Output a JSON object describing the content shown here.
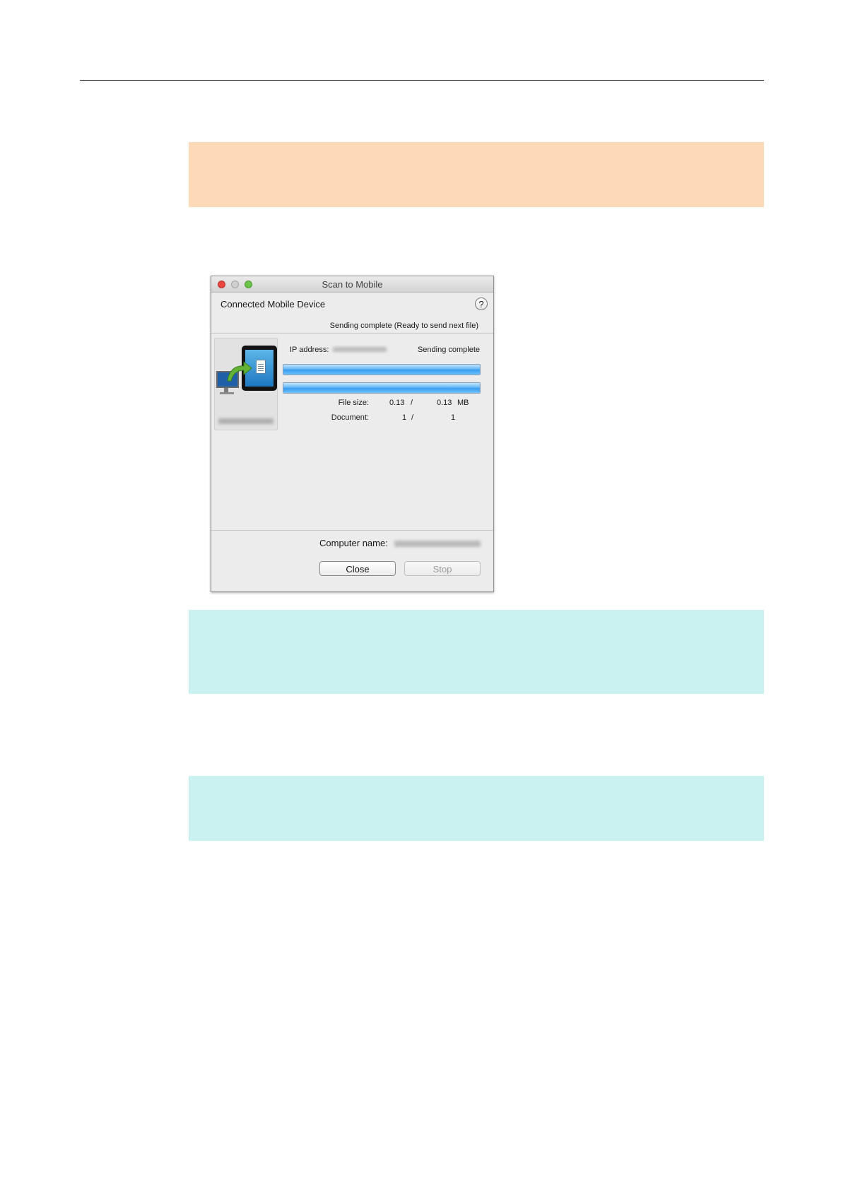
{
  "dialog": {
    "title": "Scan to Mobile",
    "header_label": "Connected Mobile Device",
    "help_label": "?",
    "status": "Sending complete (Ready to send next file)",
    "ip_label": "IP address:",
    "device_status": "Sending complete",
    "progress": [
      1.0,
      1.0
    ],
    "file_size_label": "File size:",
    "file_size_done": "0.13",
    "file_size_sep": "/",
    "file_size_total": "0.13",
    "file_size_unit": "MB",
    "document_label": "Document:",
    "document_done": "1",
    "document_sep": "/",
    "document_total": "1",
    "computer_name_label": "Computer name:",
    "close_label": "Close",
    "stop_label": "Stop"
  },
  "colors": {
    "note_orange": "#fed9b8",
    "note_cyan": "#c9f2f0",
    "progress_blue": "#3a9ef0"
  }
}
